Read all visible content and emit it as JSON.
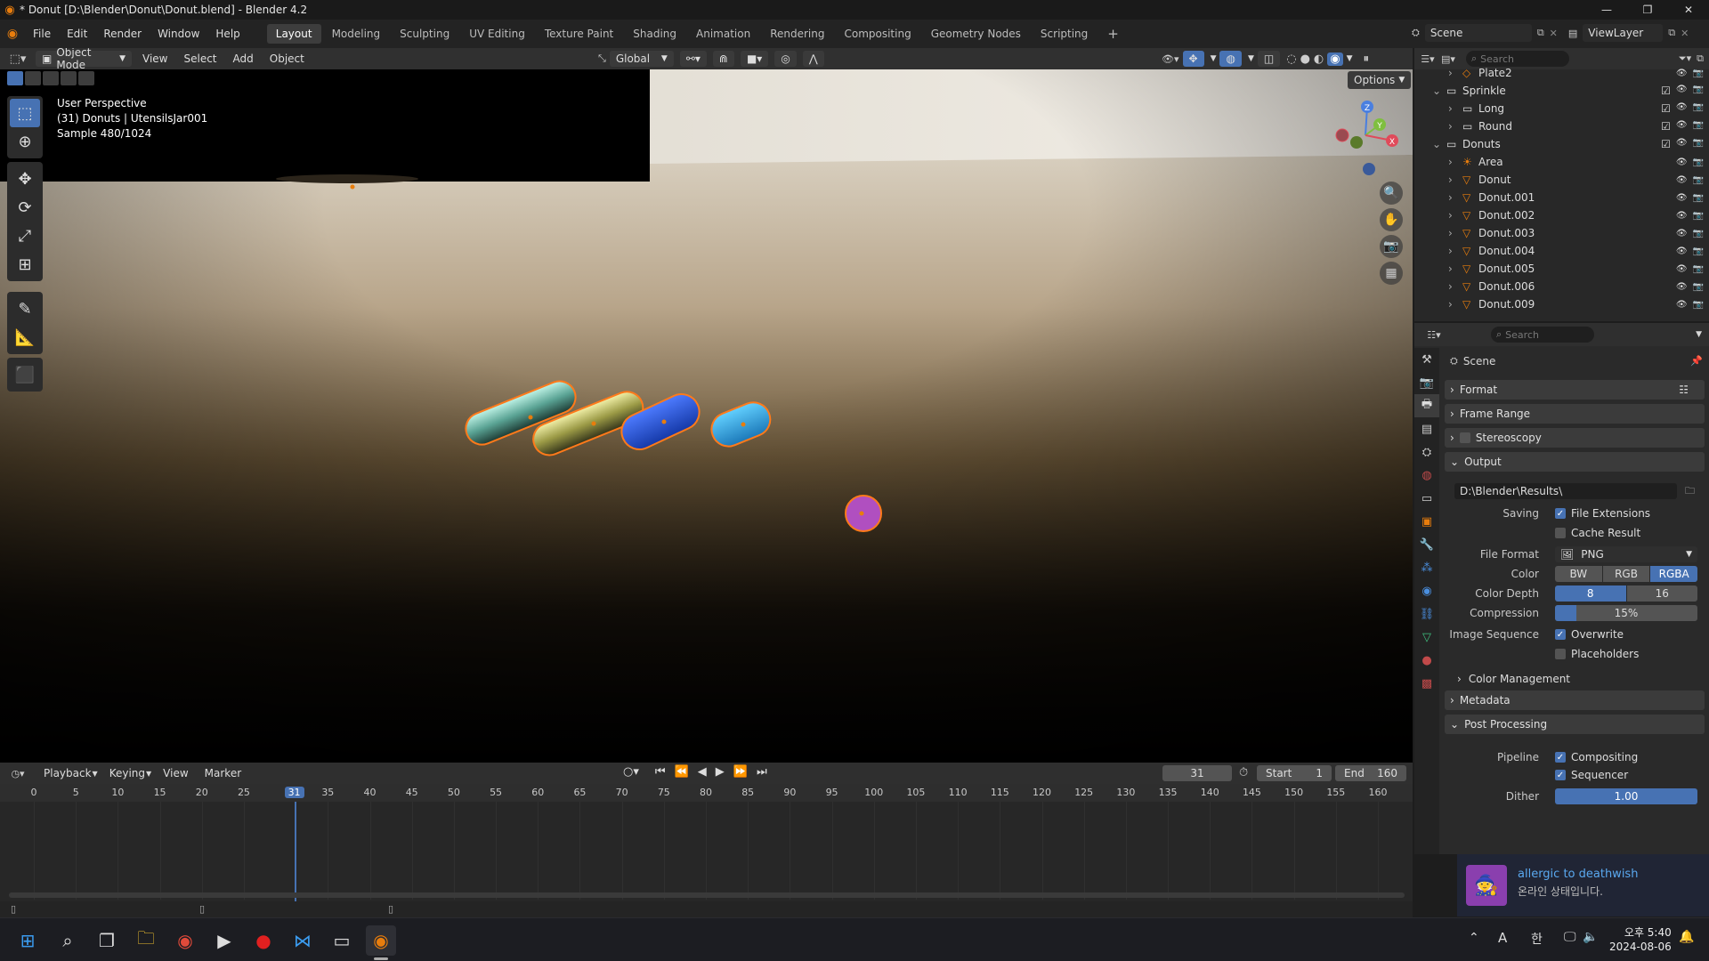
{
  "window": {
    "title": "* Donut [D:\\Blender\\Donut\\Donut.blend] - Blender 4.2",
    "controls": [
      "—",
      "❐",
      "✕"
    ]
  },
  "menubar": {
    "menus": [
      "File",
      "Edit",
      "Render",
      "Window",
      "Help"
    ],
    "workspaces": [
      "Layout",
      "Modeling",
      "Sculpting",
      "UV Editing",
      "Texture Paint",
      "Shading",
      "Animation",
      "Rendering",
      "Compositing",
      "Geometry Nodes",
      "Scripting"
    ],
    "active_workspace": "Layout",
    "scene": "Scene",
    "view_layer": "ViewLayer"
  },
  "viewport": {
    "mode": "Object Mode",
    "menus": [
      "View",
      "Select",
      "Add",
      "Object"
    ],
    "orientation": "Global",
    "options_label": "Options",
    "info": [
      "User Perspective",
      "(31) Donuts | UtensilsJar001",
      "Sample 480/1024"
    ],
    "gizmo_axes": [
      "Z",
      "Y",
      "X"
    ]
  },
  "timeline": {
    "menus": [
      "Playback",
      "Keying",
      "View",
      "Marker"
    ],
    "current_frame": "31",
    "start_label": "Start",
    "start_value": "1",
    "end_label": "End",
    "end_value": "160",
    "ticks": [
      "0",
      "5",
      "10",
      "15",
      "20",
      "25",
      "31",
      "35",
      "40",
      "45",
      "50",
      "55",
      "60",
      "65",
      "70",
      "75",
      "80",
      "85",
      "90",
      "95",
      "100",
      "105",
      "110",
      "115",
      "120",
      "125",
      "130",
      "135",
      "140",
      "145",
      "150",
      "155",
      "160"
    ]
  },
  "outliner": {
    "search_placeholder": "Search",
    "rows": [
      {
        "name": "Plate2",
        "indent": 2,
        "type": "object",
        "expanded": false
      },
      {
        "name": "Sprinkle",
        "indent": 1,
        "type": "collection",
        "expanded": true
      },
      {
        "name": "Long",
        "indent": 2,
        "type": "collection",
        "expanded": false
      },
      {
        "name": "Round",
        "indent": 2,
        "type": "collection",
        "expanded": false
      },
      {
        "name": "Donuts",
        "indent": 1,
        "type": "collection",
        "expanded": true
      },
      {
        "name": "Area",
        "indent": 2,
        "type": "light",
        "expanded": false
      },
      {
        "name": "Donut",
        "indent": 2,
        "type": "mesh",
        "expanded": false
      },
      {
        "name": "Donut.001",
        "indent": 2,
        "type": "mesh",
        "expanded": false
      },
      {
        "name": "Donut.002",
        "indent": 2,
        "type": "mesh",
        "expanded": false
      },
      {
        "name": "Donut.003",
        "indent": 2,
        "type": "mesh",
        "expanded": false
      },
      {
        "name": "Donut.004",
        "indent": 2,
        "type": "mesh",
        "expanded": false
      },
      {
        "name": "Donut.005",
        "indent": 2,
        "type": "mesh",
        "expanded": false
      },
      {
        "name": "Donut.006",
        "indent": 2,
        "type": "mesh",
        "expanded": false
      },
      {
        "name": "Donut.009",
        "indent": 2,
        "type": "mesh",
        "expanded": false
      }
    ]
  },
  "properties": {
    "search_placeholder": "Search",
    "context": "Scene",
    "panels": {
      "format": "Format",
      "frame_range": "Frame Range",
      "stereoscopy": "Stereoscopy",
      "output": "Output",
      "color_management": "Color Management",
      "metadata": "Metadata",
      "post_processing": "Post Processing"
    },
    "output_path": "D:\\Blender\\Results\\",
    "saving_label": "Saving",
    "file_extensions": "File Extensions",
    "cache_result": "Cache Result",
    "file_format_label": "File Format",
    "file_format": "PNG",
    "color_label": "Color",
    "color_options": [
      "BW",
      "RGB",
      "RGBA"
    ],
    "color_selected": "RGBA",
    "color_depth_label": "Color Depth",
    "color_depth_options": [
      "8",
      "16"
    ],
    "color_depth_selected": "8",
    "compression_label": "Compression",
    "compression": "15%",
    "compression_fraction": 0.15,
    "image_sequence_label": "Image Sequence",
    "overwrite": "Overwrite",
    "placeholders": "Placeholders",
    "pipeline_label": "Pipeline",
    "compositing": "Compositing",
    "sequencer": "Sequencer",
    "dither_label": "Dither",
    "dither": "1.00"
  },
  "notification": {
    "title": "allergic to deathwish",
    "status": "온라인 상태입니다."
  },
  "taskbar": {
    "time": "오후 5:40",
    "date": "2024-08-06",
    "ime1": "A",
    "ime2": "한"
  },
  "colors": {
    "accent": "#4772b3",
    "orange": "#e87d0d",
    "panel": "#2a2a2a",
    "header": "#303030"
  }
}
